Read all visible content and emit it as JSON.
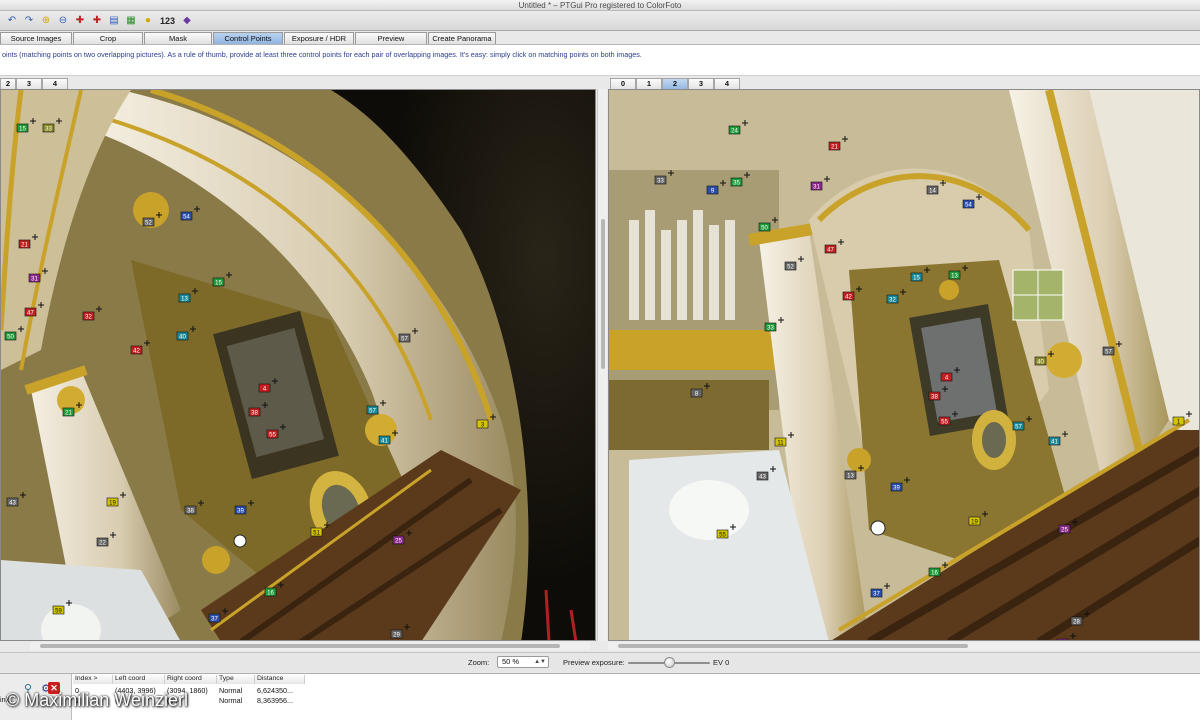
{
  "window": {
    "title": "Untitled * – PTGui Pro registered to ColorFoto"
  },
  "toolbar": {
    "icons": [
      "undo-icon",
      "redo-icon",
      "zoom-in-icon",
      "zoom-out-icon",
      "cp-left-icon",
      "cp-right-icon",
      "table-icon",
      "grid-icon",
      "bulb-icon"
    ],
    "number_label": "123"
  },
  "tabs": [
    {
      "label": "Source Images",
      "active": false
    },
    {
      "label": "Crop",
      "active": false
    },
    {
      "label": "Mask",
      "active": false
    },
    {
      "label": "Control Points",
      "active": true
    },
    {
      "label": "Exposure / HDR",
      "active": false
    },
    {
      "label": "Preview",
      "active": false
    },
    {
      "label": "Create Panorama",
      "active": false
    }
  ],
  "info": {
    "text": "oints (matching points on two overlapping pictures). As a rule of thumb, provide at least three control points for each pair of overlapping images. It's easy: simply click on matching points on both images."
  },
  "left_image_tabs": [
    {
      "label": "2",
      "active": false
    },
    {
      "label": "3",
      "active": false
    },
    {
      "label": "4",
      "active": false
    }
  ],
  "right_image_tabs": [
    {
      "label": "0",
      "active": false
    },
    {
      "label": "1",
      "active": false
    },
    {
      "label": "2",
      "active": true
    },
    {
      "label": "3",
      "active": false
    },
    {
      "label": "4",
      "active": false
    }
  ],
  "left_points": [
    {
      "n": "15",
      "c": "#1f9b3a"
    },
    {
      "n": "33",
      "c": "#8a8a2a"
    },
    {
      "n": "21",
      "c": "#c02020"
    },
    {
      "n": "31",
      "c": "#8a2a8a"
    },
    {
      "n": "50",
      "c": "#1f9b3a"
    },
    {
      "n": "52",
      "c": "#666666"
    },
    {
      "n": "47",
      "c": "#c02020"
    },
    {
      "n": "54",
      "c": "#2b4fa8"
    },
    {
      "n": "15",
      "c": "#1f9b3a"
    },
    {
      "n": "13",
      "c": "#1a8a9a"
    },
    {
      "n": "32",
      "c": "#c02020"
    },
    {
      "n": "42",
      "c": "#c02020"
    },
    {
      "n": "40",
      "c": "#1a8a9a"
    },
    {
      "n": "57",
      "c": "#666666"
    },
    {
      "n": "4",
      "c": "#c02020"
    },
    {
      "n": "38",
      "c": "#c02020"
    },
    {
      "n": "55",
      "c": "#c02020"
    },
    {
      "n": "57",
      "c": "#1a8a9a"
    },
    {
      "n": "41",
      "c": "#1a8a9a"
    },
    {
      "n": "21",
      "c": "#1f9b3a"
    },
    {
      "n": "3",
      "c": "#d4c400"
    },
    {
      "n": "38",
      "c": "#666666"
    },
    {
      "n": "39",
      "c": "#2b4fa8"
    },
    {
      "n": "19",
      "c": "#d4c400"
    },
    {
      "n": "22",
      "c": "#666666"
    },
    {
      "n": "25",
      "c": "#8a2a8a"
    },
    {
      "n": "51",
      "c": "#d4c400"
    },
    {
      "n": "43",
      "c": "#666666"
    },
    {
      "n": "37",
      "c": "#2b4fa8"
    },
    {
      "n": "16",
      "c": "#1f9b3a"
    },
    {
      "n": "29",
      "c": "#666666"
    },
    {
      "n": "59",
      "c": "#d4c400"
    }
  ],
  "right_points": [
    {
      "n": "24",
      "c": "#1f9b3a"
    },
    {
      "n": "21",
      "c": "#c02020"
    },
    {
      "n": "33",
      "c": "#666666"
    },
    {
      "n": "9",
      "c": "#2b4fa8"
    },
    {
      "n": "35",
      "c": "#1f9b3a"
    },
    {
      "n": "31",
      "c": "#8a2a8a"
    },
    {
      "n": "14",
      "c": "#666666"
    },
    {
      "n": "54",
      "c": "#2b4fa8"
    },
    {
      "n": "50",
      "c": "#1f9b3a"
    },
    {
      "n": "47",
      "c": "#c02020"
    },
    {
      "n": "52",
      "c": "#666666"
    },
    {
      "n": "15",
      "c": "#1a8a9a"
    },
    {
      "n": "13",
      "c": "#1f9b3a"
    },
    {
      "n": "42",
      "c": "#c02020"
    },
    {
      "n": "32",
      "c": "#1a8a9a"
    },
    {
      "n": "40",
      "c": "#8a8a2a"
    },
    {
      "n": "57",
      "c": "#666666"
    },
    {
      "n": "33",
      "c": "#1f9b3a"
    },
    {
      "n": "8",
      "c": "#666666"
    },
    {
      "n": "4",
      "c": "#c02020"
    },
    {
      "n": "38",
      "c": "#c02020"
    },
    {
      "n": "55",
      "c": "#c02020"
    },
    {
      "n": "57",
      "c": "#1a8a9a"
    },
    {
      "n": "41",
      "c": "#1a8a9a"
    },
    {
      "n": "11",
      "c": "#d4c400"
    },
    {
      "n": "43",
      "c": "#666666"
    },
    {
      "n": "39",
      "c": "#2b4fa8"
    },
    {
      "n": "1",
      "c": "#d4c400"
    },
    {
      "n": "19",
      "c": "#d4c400"
    },
    {
      "n": "13",
      "c": "#666666"
    },
    {
      "n": "55",
      "c": "#d4c400"
    },
    {
      "n": "37",
      "c": "#2b4fa8"
    },
    {
      "n": "16",
      "c": "#1f9b3a"
    },
    {
      "n": "25",
      "c": "#8a2a8a"
    },
    {
      "n": "28",
      "c": "#666666"
    },
    {
      "n": "33",
      "c": "#8a2a8a"
    }
  ],
  "controls": {
    "zoom_label": "Zoom:",
    "zoom_value": "50 %",
    "exposure_label": "Preview exposure:",
    "ev_label": "EV 0",
    "exposure_ev": 0
  },
  "table": {
    "headers": [
      "Index >",
      "Left coord",
      "Right coord",
      "Type",
      "Distance"
    ],
    "rows": [
      [
        "0",
        "(4403, 3996)",
        "(3094, 1860)",
        "Normal",
        "6,624350..."
      ],
      [
        "1",
        "(...)",
        "(...)",
        "Normal",
        "8,363956..."
      ]
    ],
    "row_label": "ink"
  },
  "watermark": "© Maximilian Weinzierl"
}
